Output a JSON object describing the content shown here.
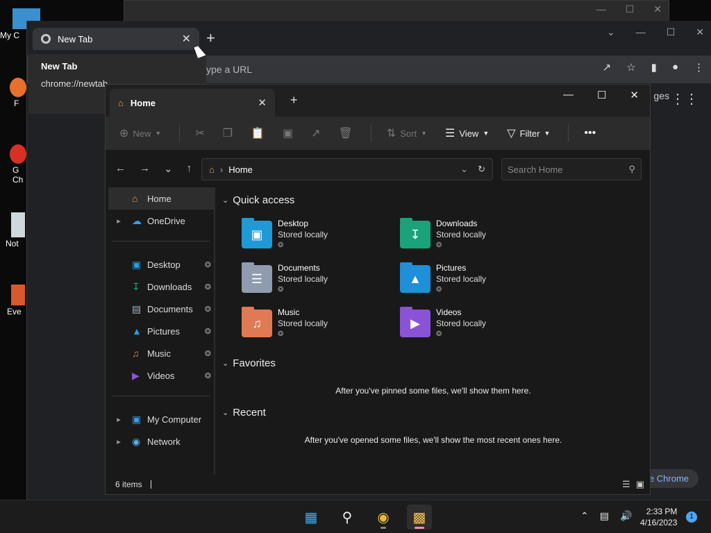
{
  "desktop": {
    "icons": [
      {
        "label": "My C"
      },
      {
        "label": "F"
      },
      {
        "label": "G Ch"
      },
      {
        "label": "Not"
      },
      {
        "label": "Eve"
      }
    ]
  },
  "chrome": {
    "tab_title": "New Tab",
    "omnibox_placeholder": "ype a URL",
    "tooltip_title": "New Tab",
    "tooltip_url": "chrome://newtab",
    "right_text": "ges",
    "customize": "e Chrome"
  },
  "explorer": {
    "tab_title": "Home",
    "toolbar": {
      "new": "New",
      "sort": "Sort",
      "view": "View",
      "filter": "Filter"
    },
    "address": "Home",
    "search_placeholder": "Search Home",
    "sidebar": [
      {
        "label": "Home",
        "icon": "home-icon"
      },
      {
        "label": "OneDrive",
        "icon": "cloud-icon"
      },
      {
        "label": "Desktop",
        "icon": "desktop-folder-icon"
      },
      {
        "label": "Downloads",
        "icon": "download-icon"
      },
      {
        "label": "Documents",
        "icon": "documents-icon"
      },
      {
        "label": "Pictures",
        "icon": "pictures-icon"
      },
      {
        "label": "Music",
        "icon": "music-icon"
      },
      {
        "label": "Videos",
        "icon": "videos-icon"
      },
      {
        "label": "My Computer",
        "icon": "computer-icon"
      },
      {
        "label": "Network",
        "icon": "network-icon"
      }
    ],
    "sections": {
      "quick_access": "Quick access",
      "favorites": "Favorites",
      "recent": "Recent"
    },
    "quick_access": [
      {
        "name": "Desktop",
        "sub": "Stored locally",
        "color": "#1f9ad6"
      },
      {
        "name": "Downloads",
        "sub": "Stored locally",
        "color": "#1aa37a"
      },
      {
        "name": "Documents",
        "sub": "Stored locally",
        "color": "#8f9cb0"
      },
      {
        "name": "Pictures",
        "sub": "Stored locally",
        "color": "#1e8fd8"
      },
      {
        "name": "Music",
        "sub": "Stored locally",
        "color": "#e07a54"
      },
      {
        "name": "Videos",
        "sub": "Stored locally",
        "color": "#8a53d6"
      }
    ],
    "favorites_msg": "After you've pinned some files, we'll show them here.",
    "recent_msg": "After you've opened some files, we'll show the most recent ones here.",
    "status": "6 items"
  },
  "taskbar": {
    "time": "2:33 PM",
    "date": "4/16/2023",
    "notifications": "1"
  }
}
